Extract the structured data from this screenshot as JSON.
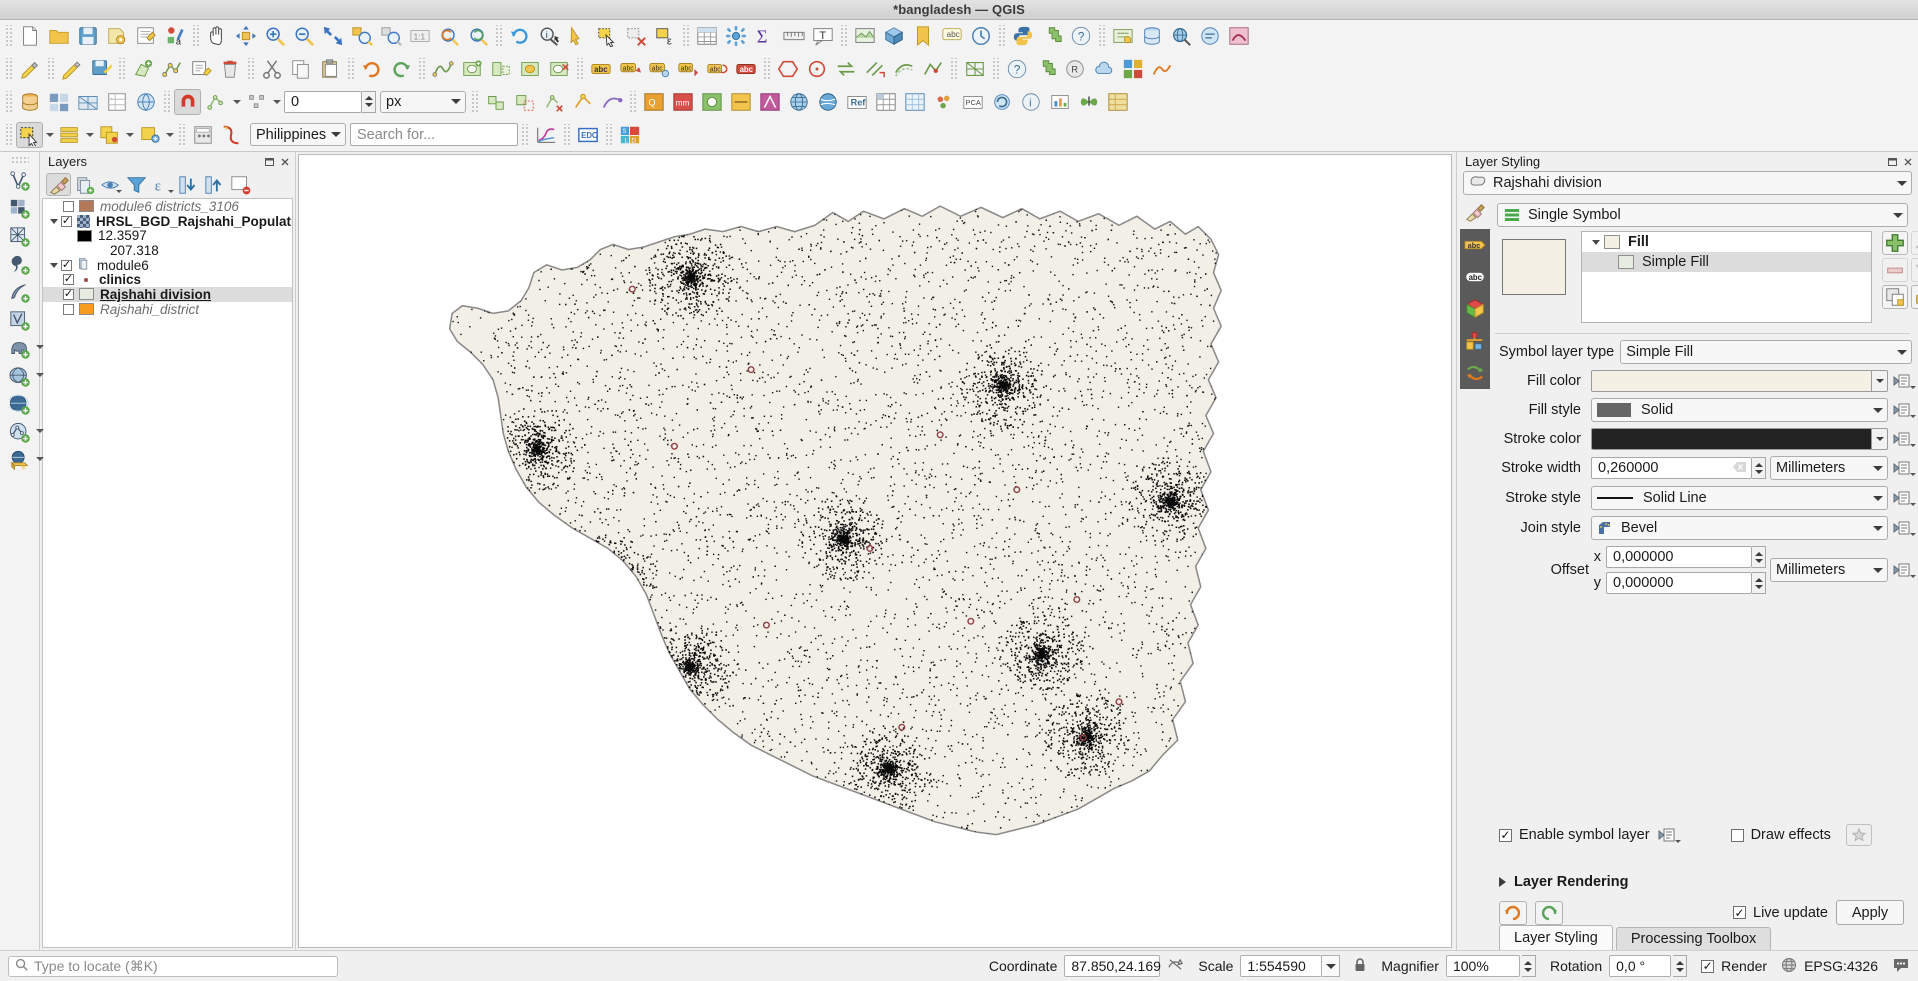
{
  "window": {
    "title": "*bangladesh — QGIS"
  },
  "toolbars": {
    "row1": [
      {
        "name": "new-project-button",
        "icon": "page"
      },
      {
        "name": "open-project-button",
        "icon": "folder"
      },
      {
        "name": "save-project-button",
        "icon": "floppy"
      },
      {
        "name": "save-project-as-button",
        "icon": "save-as"
      },
      {
        "name": "new-print-layout-button",
        "icon": "layout"
      },
      {
        "name": "style-manager-button",
        "icon": "style"
      },
      {
        "name": "pan-map-button",
        "icon": "hand"
      },
      {
        "name": "pan-to-selection-button",
        "icon": "pan-select"
      },
      {
        "name": "zoom-in-button",
        "icon": "zoom-in"
      },
      {
        "name": "zoom-out-button",
        "icon": "zoom-out"
      },
      {
        "name": "zoom-full-button",
        "icon": "zoom-full"
      },
      {
        "name": "zoom-to-selection-button",
        "icon": "zoom-sel"
      },
      {
        "name": "zoom-to-layer-button",
        "icon": "zoom-layer"
      },
      {
        "name": "zoom-native-button",
        "icon": "zoom-native"
      },
      {
        "name": "zoom-last-button",
        "icon": "zoom-last"
      },
      {
        "name": "zoom-next-button",
        "icon": "zoom-next"
      },
      {
        "name": "refresh-button",
        "icon": "refresh"
      },
      {
        "name": "identify-features-button",
        "icon": "identify"
      },
      {
        "name": "run-feature-action-button",
        "icon": "action"
      },
      {
        "name": "select-features-button",
        "icon": "select"
      },
      {
        "name": "deselect-button",
        "icon": "deselect"
      },
      {
        "name": "select-by-expression-button",
        "icon": "select-expr"
      },
      {
        "name": "open-attribute-table-button",
        "icon": "table"
      },
      {
        "name": "processing-toolbox-button",
        "icon": "gear-flower"
      },
      {
        "name": "statistics-button",
        "icon": "sigma"
      },
      {
        "name": "measure-line-button",
        "icon": "ruler"
      },
      {
        "name": "text-annotation-button",
        "icon": "text-annot"
      },
      {
        "name": "new-map-view-button",
        "icon": "map-view"
      },
      {
        "name": "new-3d-view-button",
        "icon": "view-3d"
      },
      {
        "name": "show-spatial-bookmarks-button",
        "icon": "bookmark"
      },
      {
        "name": "show-map-tips-button",
        "icon": "maptips"
      },
      {
        "name": "temporal-controller-button",
        "icon": "clock"
      },
      {
        "name": "python-console-button",
        "icon": "python"
      },
      {
        "name": "plugins-button",
        "icon": "plugin"
      },
      {
        "name": "help-button",
        "icon": "help"
      },
      {
        "name": "georeferencer-button",
        "icon": "georef"
      },
      {
        "name": "db-manager-button",
        "icon": "db"
      },
      {
        "name": "qgis-search-button",
        "icon": "search-globe"
      },
      {
        "name": "metasearch-button",
        "icon": "meta"
      },
      {
        "name": "crayfish-button",
        "icon": "crayfish"
      }
    ],
    "row2": [
      {
        "name": "current-edits-button",
        "icon": "pencil-edits"
      },
      {
        "name": "toggle-editing-button",
        "icon": "pencil"
      },
      {
        "name": "save-layer-edits-button",
        "icon": "save-edits"
      },
      {
        "name": "add-feature-button",
        "icon": "add-feature"
      },
      {
        "name": "vertex-tool-button",
        "icon": "vertex"
      },
      {
        "name": "modify-attributes-button",
        "icon": "modify-attr"
      },
      {
        "name": "delete-selected-button",
        "icon": "trash"
      },
      {
        "name": "cut-features-button",
        "icon": "cut"
      },
      {
        "name": "copy-features-button",
        "icon": "copy"
      },
      {
        "name": "paste-features-button",
        "icon": "paste"
      },
      {
        "name": "undo-button",
        "icon": "undo"
      },
      {
        "name": "redo-button",
        "icon": "redo"
      },
      {
        "name": "simplify-feature-button",
        "icon": "simplify"
      },
      {
        "name": "add-ring-button",
        "icon": "add-ring"
      },
      {
        "name": "add-part-button",
        "icon": "add-part"
      },
      {
        "name": "fill-ring-button",
        "icon": "fill-ring"
      },
      {
        "name": "delete-ring-button",
        "icon": "del-ring"
      },
      {
        "name": "label-toolbar-button",
        "icon": "abc-label"
      },
      {
        "name": "pin-labels-button",
        "icon": "pin-label"
      },
      {
        "name": "show-hide-labels-button",
        "icon": "show-label"
      },
      {
        "name": "move-label-button",
        "icon": "move-label"
      },
      {
        "name": "rotate-label-button",
        "icon": "rotate-label"
      },
      {
        "name": "change-label-button",
        "icon": "change-label"
      },
      {
        "name": "shape-digitize-button",
        "icon": "hexagon"
      },
      {
        "name": "shape-circle-button",
        "icon": "circle-shape"
      },
      {
        "name": "reverse-line-button",
        "icon": "reverse"
      },
      {
        "name": "trim-extend-button",
        "icon": "trim"
      },
      {
        "name": "offset-curve-button",
        "icon": "offset"
      },
      {
        "name": "reshape-button",
        "icon": "reshape"
      },
      {
        "name": "mesh-digitizing-button",
        "icon": "mesh"
      },
      {
        "name": "help-contents-button",
        "icon": "help2"
      },
      {
        "name": "plugin-manager-button",
        "icon": "plugin2"
      },
      {
        "name": "qgis-resources-button",
        "icon": "res"
      },
      {
        "name": "qgis-cloud-button",
        "icon": "cloud"
      },
      {
        "name": "semi-automatic-classification-button",
        "icon": "scp"
      },
      {
        "name": "freehand-editing-button",
        "icon": "freehand"
      }
    ],
    "row3": [
      {
        "name": "open-data-source-manager-button",
        "icon": "datasrc"
      },
      {
        "name": "add-raster-button",
        "icon": "raster"
      },
      {
        "name": "add-mesh-button",
        "icon": "meshlayer"
      },
      {
        "name": "add-delimited-text-button",
        "icon": "csv"
      },
      {
        "name": "add-wfs-button",
        "icon": "wfs"
      },
      {
        "name": "snapping-toggle-button",
        "icon": "magnet",
        "active": true
      },
      {
        "name": "snapping-mode-button",
        "icon": "snap-vertex"
      },
      {
        "name": "snapping-type-button",
        "icon": "snap-type"
      },
      {
        "name": "snapping-tolerance-input",
        "icon": "spin"
      },
      {
        "name": "snapping-units-select",
        "icon": "combo"
      },
      {
        "name": "enable-topological-editing-button",
        "icon": "topo"
      },
      {
        "name": "avoid-overlap-button",
        "icon": "avoid"
      },
      {
        "name": "delete-vertex-button",
        "icon": "delvertex"
      },
      {
        "name": "snap-geometries-button",
        "icon": "snapgeom"
      },
      {
        "name": "trace-button",
        "icon": "trace"
      },
      {
        "name": "plugin-qc-button",
        "icon": "qc"
      },
      {
        "name": "plugin-mmqgis-button",
        "icon": "mm"
      },
      {
        "name": "plugin-openlayers-button",
        "icon": "ol"
      },
      {
        "name": "plugin-qgis2web-button",
        "icon": "web"
      },
      {
        "name": "plugin-qnetwork-button",
        "icon": "net"
      },
      {
        "name": "plugin-globe-button",
        "icon": "globe1"
      },
      {
        "name": "plugin-worldmap-button",
        "icon": "globe2"
      },
      {
        "name": "plugin-ref-button",
        "icon": "ref"
      },
      {
        "name": "plugin-grid-button",
        "icon": "grid"
      },
      {
        "name": "plugin-grid2-button",
        "icon": "grid2"
      },
      {
        "name": "plugin-cluster-button",
        "icon": "cluster"
      },
      {
        "name": "plugin-pca-button",
        "icon": "pca"
      },
      {
        "name": "plugin-sync-button",
        "icon": "sync"
      },
      {
        "name": "plugin-info-button",
        "icon": "info"
      },
      {
        "name": "plugin-chart-button",
        "icon": "chart"
      },
      {
        "name": "plugin-butterfly-button",
        "icon": "butterfly"
      },
      {
        "name": "plugin-grid3-button",
        "icon": "grid3"
      }
    ],
    "row4": {
      "buttons": [
        {
          "name": "select-features-by-area-button",
          "icon": "sel-area",
          "active": true
        },
        {
          "name": "select-by-form-button",
          "icon": "sel-form"
        },
        {
          "name": "select-by-location-button",
          "icon": "sel-loc"
        },
        {
          "name": "select-by-value-button",
          "icon": "sel-value"
        },
        {
          "name": "raster-calculator-button",
          "icon": "calcicon"
        },
        {
          "name": "curve-tool-button",
          "icon": "curvetool"
        }
      ],
      "search_scope": "Philippines",
      "search_placeholder": "Search for...",
      "after_buttons": [
        {
          "name": "profile-tool-button",
          "icon": "profile"
        },
        {
          "name": "edc-button",
          "icon": "edc"
        },
        {
          "name": "sld-button",
          "icon": "sld"
        }
      ]
    },
    "snapping_tolerance": "0",
    "snapping_units": "px"
  },
  "left_vtoolbar": [
    {
      "name": "new-shapefile-layer-button",
      "icon": "v-vector"
    },
    {
      "name": "new-geopackage-layer-button",
      "icon": "v-raster"
    },
    {
      "name": "new-spatialite-layer-button",
      "icon": "v-grid"
    },
    {
      "name": "new-temporary-scratch-layer-button",
      "icon": "v-comma"
    },
    {
      "name": "new-gpx-layer-button",
      "icon": "v-feather"
    },
    {
      "name": "add-vector-layer-button",
      "icon": "v-vectoradd"
    },
    {
      "name": "add-postgis-layer-button",
      "icon": "v-elephant",
      "dropdown": true
    },
    {
      "name": "add-spatialite-layer-button",
      "icon": "v-globe1",
      "dropdown": true
    },
    {
      "name": "add-wms-layer-button",
      "icon": "v-globe2"
    },
    {
      "name": "add-wfs-layer-button",
      "icon": "v-vectorweb",
      "dropdown": true
    },
    {
      "name": "add-virtual-layer-button",
      "icon": "v-globebox",
      "dropdown": true
    }
  ],
  "layers_panel": {
    "title": "Layers",
    "toolbar": [
      {
        "name": "open-layer-styling-panel-button",
        "icon": "brush",
        "active": true
      },
      {
        "name": "add-group-button",
        "icon": "addgroup"
      },
      {
        "name": "manage-map-themes-button",
        "icon": "eye",
        "dropdown": true
      },
      {
        "name": "filter-legend-button",
        "icon": "funnel"
      },
      {
        "name": "filter-legend-expression-button",
        "icon": "epsilon",
        "dropdown": true
      },
      {
        "name": "expand-all-button",
        "icon": "expandall"
      },
      {
        "name": "collapse-all-button",
        "icon": "collapseall"
      },
      {
        "name": "remove-layer-button",
        "icon": "removelayer"
      }
    ],
    "tree": [
      {
        "name": "layer-module6-districts",
        "label": "module6 districts_3106",
        "indent": 1,
        "checkbox": "unchecked",
        "swatch": "#b4785a",
        "style": "italic",
        "expand": false
      },
      {
        "name": "layer-hrsl-bgd-rajshahi-population",
        "label": "HRSL_BGD_Rajshahi_Population",
        "indent": 0,
        "checkbox": "checked",
        "swatch": "raster",
        "style": "bold",
        "expand": true
      },
      {
        "name": "legend-entry-min",
        "label": "12.3597",
        "indent": 2,
        "checkbox": "none",
        "swatch": "#000000",
        "style": "normal",
        "expand": false
      },
      {
        "name": "legend-entry-max",
        "label": "207.318",
        "indent": 3,
        "checkbox": "none",
        "swatch": "none",
        "style": "normal",
        "expand": false
      },
      {
        "name": "layer-group-module6",
        "label": "module6",
        "indent": 0,
        "checkbox": "checked",
        "swatch": "group",
        "style": "normal",
        "expand": true
      },
      {
        "name": "layer-clinics",
        "label": "clinics",
        "indent": 1,
        "checkbox": "checked",
        "swatch": "dot",
        "style": "bold",
        "expand": false
      },
      {
        "name": "layer-rajshahi-division",
        "label": "Rajshahi division",
        "indent": 1,
        "checkbox": "checked",
        "swatch": "#e6ece0",
        "style": "selected",
        "expand": false
      },
      {
        "name": "layer-rajshahi-district",
        "label": "Rajshahi_district",
        "indent": 1,
        "checkbox": "unchecked",
        "swatch": "#f59d1e",
        "style": "italic",
        "expand": false
      }
    ]
  },
  "map": {
    "fill_color": "#f2efe6",
    "stroke_color": "#8a8a8a",
    "background": "#ffffff"
  },
  "layer_styling": {
    "title": "Layer Styling",
    "layer_name": "Rajshahi division",
    "renderer": "Single Symbol",
    "sidebar_tabs": [
      {
        "name": "symbology-tab",
        "icon": "brush"
      },
      {
        "name": "labels-tab",
        "icon": "abc-yellow"
      },
      {
        "name": "masks-tab",
        "icon": "abc-white"
      },
      {
        "name": "3d-view-tab",
        "icon": "cube"
      },
      {
        "name": "diagrams-tab",
        "icon": "diagram"
      },
      {
        "name": "history-tab",
        "icon": "history"
      }
    ],
    "symbol_tree": [
      {
        "name": "symbol-root-fill",
        "label": "Fill",
        "level": 0,
        "swatch": "#f4f0e6",
        "selected": false
      },
      {
        "name": "symbol-layer-simple-fill",
        "label": "Simple Fill",
        "level": 1,
        "swatch": "#e6ece0",
        "selected": true
      }
    ],
    "symbol_tree_buttons": [
      {
        "name": "add-symbol-layer-button",
        "icon": "plus-green",
        "disabled": false
      },
      {
        "name": "move-symbol-up-button",
        "icon": "tri-up",
        "disabled": true
      },
      {
        "name": "remove-symbol-layer-button",
        "icon": "minus-red",
        "disabled": true
      },
      {
        "name": "move-symbol-down-button",
        "icon": "tri-down",
        "disabled": true
      },
      {
        "name": "duplicate-symbol-layer-button",
        "icon": "duplicate",
        "disabled": false
      },
      {
        "name": "lock-layer-colors-button",
        "icon": "lock-open",
        "disabled": false
      }
    ],
    "fields": {
      "symbol_layer_type_label": "Symbol layer type",
      "symbol_layer_type_value": "Simple Fill",
      "fill_color_label": "Fill color",
      "fill_color_value": "#f4f0e6",
      "fill_style_label": "Fill style",
      "fill_style_value": "Solid",
      "stroke_color_label": "Stroke color",
      "stroke_color_value": "#232323",
      "stroke_width_label": "Stroke width",
      "stroke_width_value": "0,260000",
      "stroke_width_unit": "Millimeters",
      "stroke_style_label": "Stroke style",
      "stroke_style_value": "Solid Line",
      "join_style_label": "Join style",
      "join_style_value": "Bevel",
      "offset_label": "Offset",
      "offset_x_label": "x",
      "offset_x_value": "0,000000",
      "offset_y_label": "y",
      "offset_y_value": "0,000000",
      "offset_unit": "Millimeters"
    },
    "enable_symbol_layer_label": "Enable symbol layer",
    "enable_symbol_layer_checked": true,
    "draw_effects_label": "Draw effects",
    "draw_effects_checked": false,
    "layer_rendering_label": "Layer Rendering",
    "live_update_label": "Live update",
    "live_update_checked": true,
    "apply_label": "Apply"
  },
  "dock_tabs": [
    {
      "name": "tab-layer-styling",
      "label": "Layer Styling",
      "active": true
    },
    {
      "name": "tab-processing-toolbox",
      "label": "Processing Toolbox",
      "active": false
    }
  ],
  "statusbar": {
    "locate_placeholder": "Type to locate (⌘K)",
    "coordinate_label": "Coordinate",
    "coordinate_value": "87.850,24.169",
    "scale_label": "Scale",
    "scale_value": "1:554590",
    "magnifier_label": "Magnifier",
    "magnifier_value": "100%",
    "rotation_label": "Rotation",
    "rotation_value": "0,0 °",
    "render_label": "Render",
    "render_checked": true,
    "crs_label": "EPSG:4326"
  }
}
